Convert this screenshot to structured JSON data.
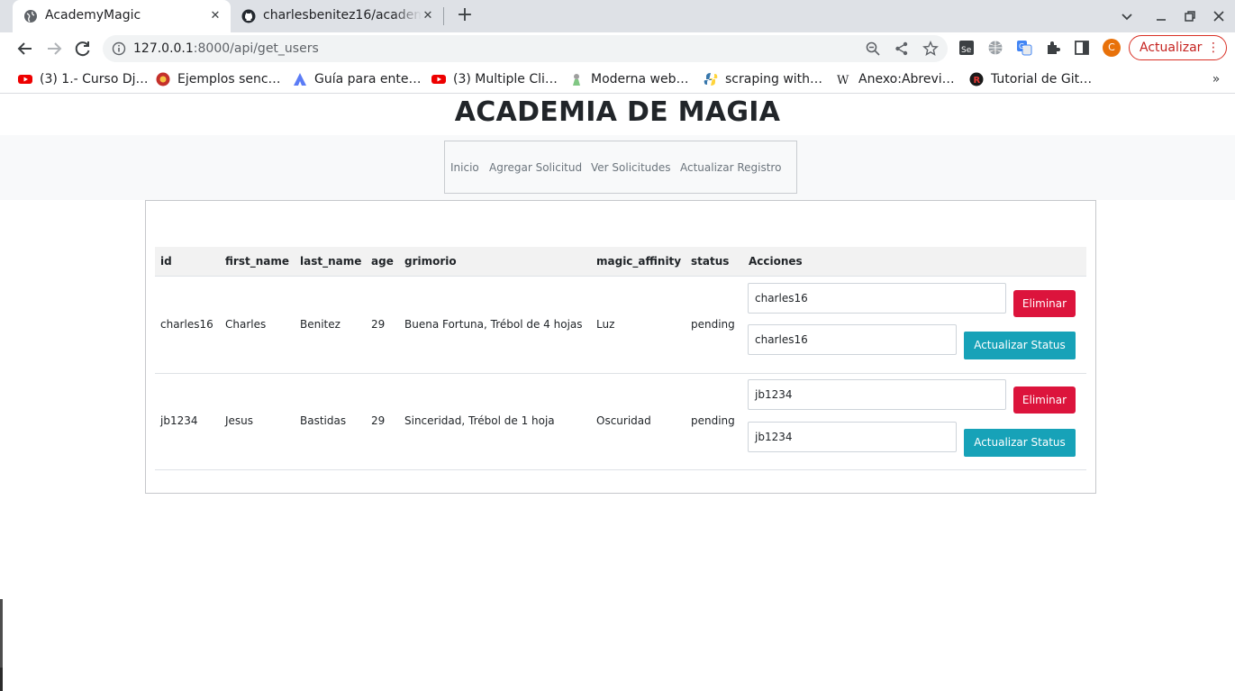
{
  "browser": {
    "tabs": [
      {
        "title": "AcademyMagic",
        "active": true
      },
      {
        "title": "charlesbenitez16/academ",
        "active": false
      }
    ],
    "url_host": "127.0.0.1",
    "url_rest": ":8000/api/get_users",
    "update_label": "Actualizar",
    "profile_initial": "C",
    "bookmarks": [
      {
        "label": "(3) 1.- Curso Dj…",
        "icon": "youtube-icon"
      },
      {
        "label": "Ejemplos senc…",
        "icon": "site-icon"
      },
      {
        "label": "Guía para ente…",
        "icon": "site-icon"
      },
      {
        "label": "(3) Multiple Cli…",
        "icon": "youtube-icon"
      },
      {
        "label": "Moderna web…",
        "icon": "site-icon"
      },
      {
        "label": "scraping with…",
        "icon": "python-icon"
      },
      {
        "label": "Anexo:Abrevi…",
        "icon": "wikipedia-icon"
      },
      {
        "label": "Tutorial de Git…",
        "icon": "site-icon"
      }
    ],
    "bookmarks_more": "»",
    "colors": {
      "update": "#d93025",
      "profile": "#e8710a"
    }
  },
  "page": {
    "title": "ACADEMIA DE MAGIA",
    "nav": [
      "Inicio",
      "Agregar Solicitud",
      "Ver Solicitudes",
      "Actualizar Registro"
    ],
    "table": {
      "headers": [
        "id",
        "first_name",
        "last_name",
        "age",
        "grimorio",
        "magic_affinity",
        "status",
        "Acciones"
      ],
      "rows": [
        {
          "id": "charles16",
          "first_name": "Charles",
          "last_name": "Benitez",
          "age": "29",
          "grimorio": "Buena Fortuna, Trébol de 4 hojas",
          "magic_affinity": "Luz",
          "status": "pending",
          "input_delete": "charles16",
          "input_update": "charles16"
        },
        {
          "id": "jb1234",
          "first_name": "Jesus",
          "last_name": "Bastidas",
          "age": "29",
          "grimorio": "Sinceridad, Trébol de 1 hoja",
          "magic_affinity": "Oscuridad",
          "status": "pending",
          "input_delete": "jb1234",
          "input_update": "jb1234"
        }
      ]
    },
    "delete_label": "Eliminar",
    "update_status_label": "Actualizar Status",
    "colors": {
      "delete": "#dc143c",
      "update_status": "#17a2b8",
      "nav_band": "#f8f9fa",
      "table_header": "#f2f2f2"
    }
  }
}
